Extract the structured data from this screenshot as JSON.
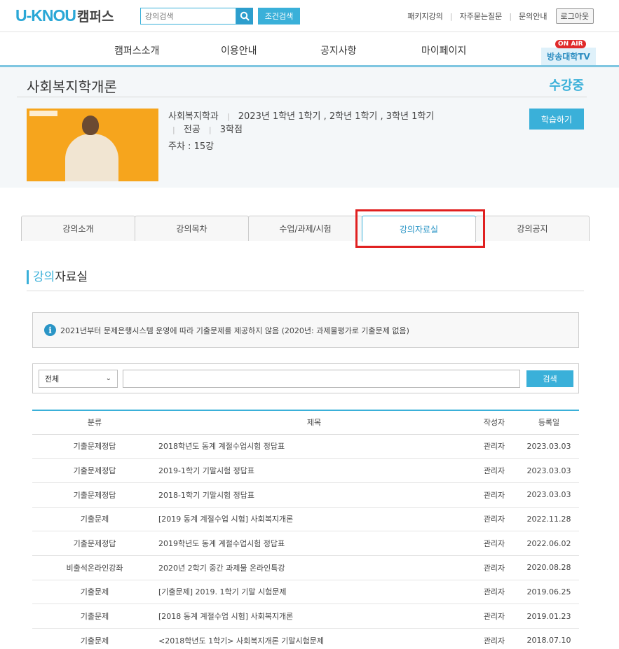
{
  "header": {
    "logo_text": "U-KNOU",
    "logo_suffix": "캠퍼스",
    "search_placeholder": "강의검색",
    "search_icon": "search-icon",
    "cond_search_label": "조건검색",
    "links": [
      "패키지강의",
      "자주묻는질문",
      "문의안내"
    ],
    "logout_label": "로그아웃"
  },
  "nav": {
    "items": [
      "캠퍼스소개",
      "이용안내",
      "공지사항",
      "마이페이지"
    ],
    "onair_label": "ON AIR",
    "tv_label": "방송대학TV"
  },
  "course": {
    "title": "사회복지학개론",
    "status": "수강중",
    "department": "사회복지학과",
    "years": "2023년  1학년 1학기 , 2학년 1학기 , 3학년 1학기",
    "type": "전공",
    "credits": "3학점",
    "weeks": "주차 : 15강",
    "learn_label": "학습하기"
  },
  "tabs": [
    "강의소개",
    "강의목차",
    "수업/과제/시험",
    "강의자료실",
    "강의공지"
  ],
  "active_tab": 3,
  "section": {
    "title_highlight": "강의",
    "title_rest": "자료실"
  },
  "notice": {
    "text": "2021년부터 문제은행시스템 운영에 따라 기출문제를 제공하지 않음 (2020년: 과제물평가로 기출문제 없음)"
  },
  "filter": {
    "select_value": "전체",
    "search_label": "검색"
  },
  "table": {
    "headers": {
      "category": "분류",
      "title": "제목",
      "author": "작성자",
      "date": "등록일"
    },
    "rows": [
      {
        "category": "기출문제정답",
        "title": "2018학년도 동계 계절수업시험 정답표",
        "author": "관리자",
        "date": "2023.03.03"
      },
      {
        "category": "기출문제정답",
        "title": "2019-1학기 기말시험 정답표",
        "author": "관리자",
        "date": "2023.03.03"
      },
      {
        "category": "기출문제정답",
        "title": "2018-1학기 기말시험 정답표",
        "author": "관리자",
        "date": "2023.03.03"
      },
      {
        "category": "기출문제",
        "title": "[2019 동계 계절수업 시험] 사회복지개론",
        "author": "관리자",
        "date": "2022.11.28"
      },
      {
        "category": "기출문제정답",
        "title": "2019학년도 동계 계절수업시험 정답표",
        "author": "관리자",
        "date": "2022.06.02"
      },
      {
        "category": "비출석온라인강좌",
        "title": "2020년 2학기 중간 과제물 온라인특강",
        "author": "관리자",
        "date": "2020.08.28"
      },
      {
        "category": "기출문제",
        "title": "[기출문제] 2019. 1학기 기말 시험문제",
        "author": "관리자",
        "date": "2019.06.25"
      },
      {
        "category": "기출문제",
        "title": "[2018 동계 계절수업 시험] 사회복지개론",
        "author": "관리자",
        "date": "2019.01.23"
      },
      {
        "category": "기출문제",
        "title": "<2018학년도 1학기> 사회복지개론 기말시험문제",
        "author": "관리자",
        "date": "2018.07.10"
      }
    ]
  }
}
